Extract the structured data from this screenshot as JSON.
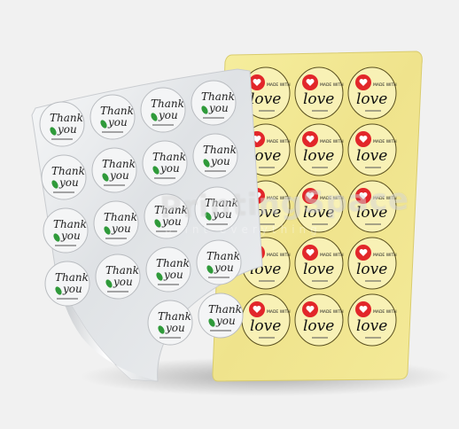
{
  "scene": {
    "description_colors": {
      "background": "#f1f1f1",
      "silver_sheet": "#e3e5e8",
      "gold_sheet": "#f1e79a",
      "heart_red": "#e2262a",
      "leaf_green": "#2f9a3a"
    }
  },
  "silver_sticker": {
    "line1": "Thank",
    "line2": "you"
  },
  "gold_sticker": {
    "line1": "MADE WITH",
    "line2": "love"
  },
  "watermark": {
    "brand": "PrintingSpace",
    "tagline": "print everything"
  },
  "silver_grid": {
    "rows": 5,
    "cols": 4
  },
  "gold_grid": {
    "rows": 5,
    "cols": 3
  }
}
